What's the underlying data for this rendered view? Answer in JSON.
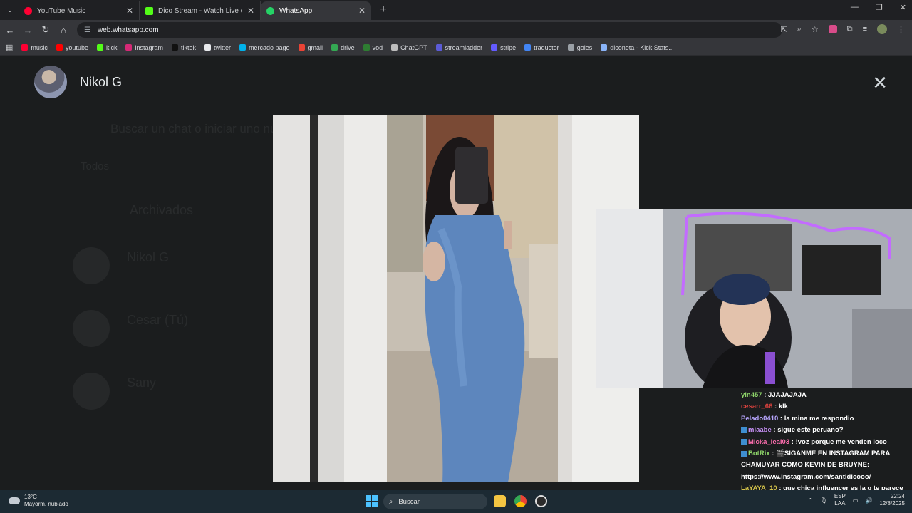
{
  "browser": {
    "tabs": [
      {
        "title": "YouTube Music",
        "color": "#ff0033"
      },
      {
        "title": "Dico Stream - Watch Live on Kick",
        "color": "#53fc18"
      },
      {
        "title": "WhatsApp",
        "color": "#25d366"
      }
    ],
    "url": "web.whatsapp.com",
    "bookmarks": [
      {
        "label": "music",
        "color": "#ff0033"
      },
      {
        "label": "youtube",
        "color": "#ff0000"
      },
      {
        "label": "kick",
        "color": "#53fc18"
      },
      {
        "label": "instagram",
        "color": "#d62976"
      },
      {
        "label": "tiktok",
        "color": "#111111"
      },
      {
        "label": "twitter",
        "color": "#e8eaed"
      },
      {
        "label": "mercado pago",
        "color": "#00b1ea"
      },
      {
        "label": "gmail",
        "color": "#ea4335"
      },
      {
        "label": "drive",
        "color": "#34a853"
      },
      {
        "label": "vod",
        "color": "#2e7d32"
      },
      {
        "label": "ChatGPT",
        "color": "#bdbdbd"
      },
      {
        "label": "streamladder",
        "color": "#5b5bd6"
      },
      {
        "label": "stripe",
        "color": "#635bff"
      },
      {
        "label": "traductor",
        "color": "#4285f4"
      },
      {
        "label": "goles",
        "color": "#9aa0a6"
      },
      {
        "label": "diconeta - Kick Stats...",
        "color": "#8ab4f8"
      }
    ]
  },
  "viewer": {
    "contact_name": "Nikol G",
    "background_ghost": {
      "search": "Buscar un chat o iniciar uno nuevo",
      "filter": "Todos",
      "archived": "Archivados",
      "chat1": "Nikol G",
      "chat2": "Cesar (Tú)",
      "chat3": "Sany"
    }
  },
  "chat": {
    "messages": [
      {
        "user": "yin457",
        "user_color": "#8fd66a",
        "text": "JJAJAJAJA",
        "badge": false
      },
      {
        "user": "cesarr_66",
        "user_color": "#d6413d",
        "text": "klk",
        "badge": false
      },
      {
        "user": "Pelado0410",
        "user_color": "#b8a6ff",
        "text": "la mina me respondio",
        "badge": false
      },
      {
        "user": "miaabe",
        "user_color": "#c28df0",
        "text": "sigue este peruano?",
        "badge": true
      },
      {
        "user": "Micka_leal03",
        "user_color": "#ff6fb0",
        "text": "!voz porque me venden loco",
        "badge": true
      },
      {
        "user": "BotRix",
        "user_color": "#8fd66a",
        "text": "🎬SIGANME EN INSTAGRAM PARA CHAMUYAR COMO KEVIN DE BRUYNE: https://www.instagram.com/santidicooo/",
        "badge": true
      },
      {
        "user": "LaYAYA_10",
        "user_color": "#d4c24a",
        "text": "que chica influencer es la q te parece más linda",
        "badge": false
      }
    ]
  },
  "taskbar": {
    "weather_temp": "13°C",
    "weather_desc": "Mayorm. nublado",
    "search_placeholder": "Buscar",
    "lang_top": "ESP",
    "lang_bottom": "LAA",
    "time": "22:24",
    "date": "12/8/2025"
  }
}
